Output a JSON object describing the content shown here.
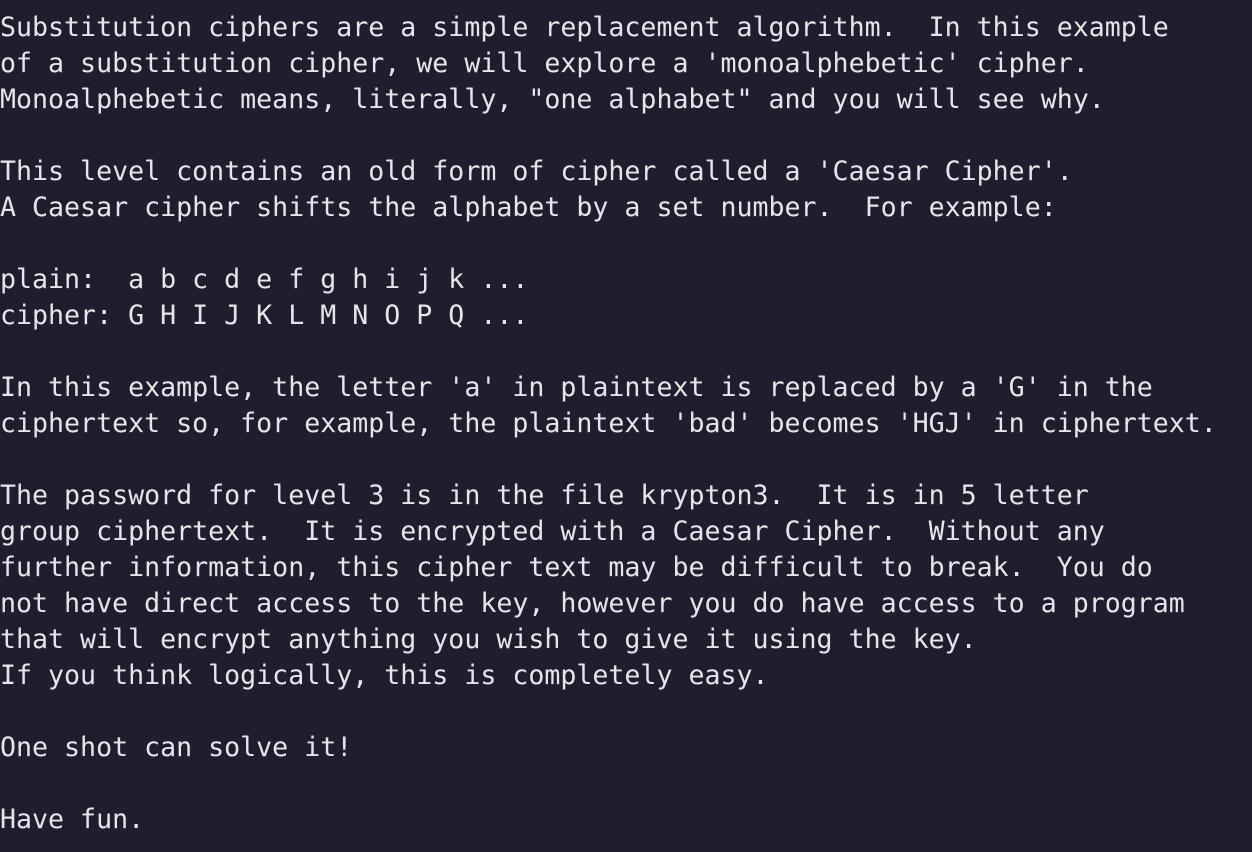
{
  "terminal": {
    "lines": [
      "Substitution ciphers are a simple replacement algorithm.  In this example",
      "of a substitution cipher, we will explore a 'monoalphebetic' cipher.",
      "Monoalphebetic means, literally, \"one alphabet\" and you will see why.",
      "",
      "This level contains an old form of cipher called a 'Caesar Cipher'.",
      "A Caesar cipher shifts the alphabet by a set number.  For example:",
      "",
      "plain:  a b c d e f g h i j k ...",
      "cipher: G H I J K L M N O P Q ...",
      "",
      "In this example, the letter 'a' in plaintext is replaced by a 'G' in the",
      "ciphertext so, for example, the plaintext 'bad' becomes 'HGJ' in ciphertext.",
      "",
      "The password for level 3 is in the file krypton3.  It is in 5 letter",
      "group ciphertext.  It is encrypted with a Caesar Cipher.  Without any",
      "further information, this cipher text may be difficult to break.  You do",
      "not have direct access to the key, however you do have access to a program",
      "that will encrypt anything you wish to give it using the key.",
      "If you think logically, this is completely easy.",
      "",
      "One shot can solve it!",
      "",
      "Have fun."
    ]
  }
}
